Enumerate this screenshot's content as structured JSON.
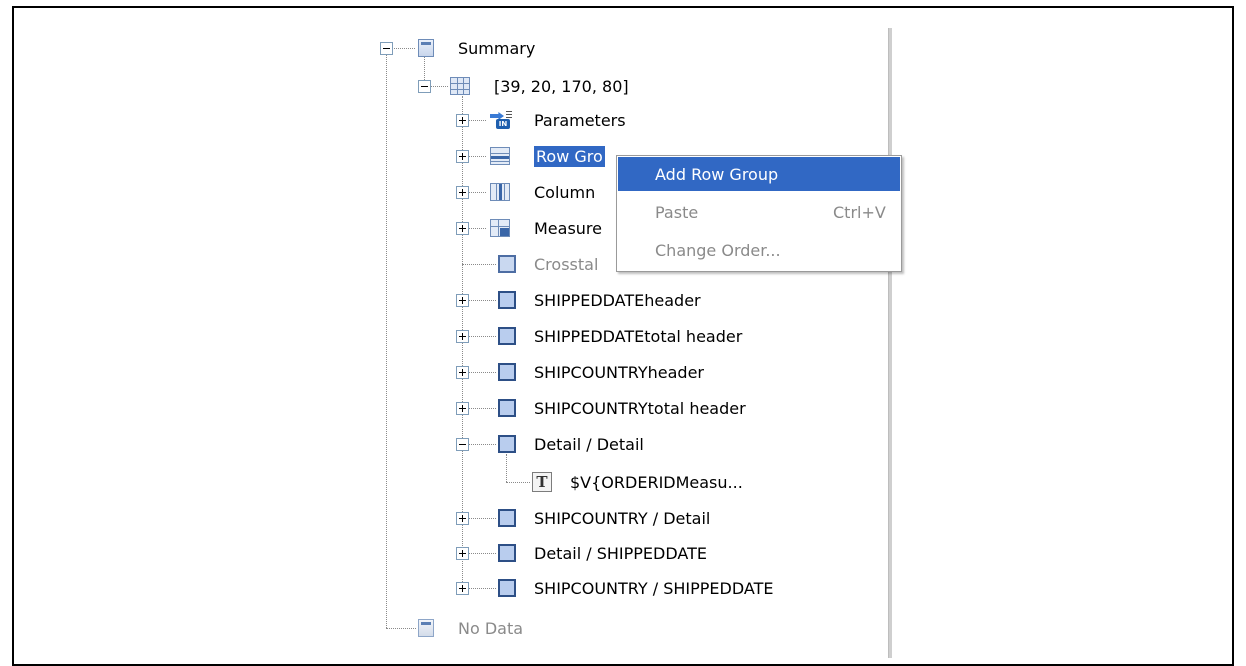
{
  "tree": {
    "items": [
      {
        "id": "summary",
        "label": "Summary",
        "icon": "band-icon",
        "expander": "minus",
        "enabled": true
      },
      {
        "id": "crosstab",
        "label": "[39, 20, 170, 80]",
        "icon": "crosstab-icon",
        "expander": "minus",
        "enabled": true
      },
      {
        "id": "parameters",
        "label": "Parameters",
        "icon": "parameters-icon",
        "expander": "plus",
        "enabled": true
      },
      {
        "id": "row-groups",
        "label": "Row Groups",
        "icon": "row-group-icon",
        "expander": "plus",
        "selected": true,
        "enabled": true
      },
      {
        "id": "column-groups",
        "label": "Column Groups",
        "icon": "column-group-icon",
        "expander": "plus",
        "enabled": true
      },
      {
        "id": "measures",
        "label": "Measures",
        "icon": "measure-icon",
        "expander": "plus",
        "enabled": true
      },
      {
        "id": "crosstab-header",
        "label": "Crosstab header",
        "icon": "cell-icon",
        "expander": "none",
        "enabled": false
      },
      {
        "id": "shippeddate-header",
        "label": "SHIPPEDDATEheader",
        "icon": "cell-icon",
        "expander": "plus",
        "enabled": true
      },
      {
        "id": "shippeddate-total-header",
        "label": "SHIPPEDDATEtotal header",
        "icon": "cell-icon",
        "expander": "plus",
        "enabled": true
      },
      {
        "id": "shipcountry-header",
        "label": "SHIPCOUNTRYheader",
        "icon": "cell-icon",
        "expander": "plus",
        "enabled": true
      },
      {
        "id": "shipcountry-total-header",
        "label": "SHIPCOUNTRYtotal header",
        "icon": "cell-icon",
        "expander": "plus",
        "enabled": true
      },
      {
        "id": "detail-detail",
        "label": "Detail / Detail",
        "icon": "cell-icon",
        "expander": "minus",
        "enabled": true
      },
      {
        "id": "orderid-measure",
        "label": "$V{ORDERIDMeasu...",
        "icon": "text-field-icon",
        "expander": "none",
        "enabled": true
      },
      {
        "id": "shipcountry-detail",
        "label": "SHIPCOUNTRY / Detail",
        "icon": "cell-icon",
        "expander": "plus",
        "enabled": true
      },
      {
        "id": "detail-shippeddate",
        "label": "Detail / SHIPPEDDATE",
        "icon": "cell-icon",
        "expander": "plus",
        "enabled": true
      },
      {
        "id": "shipcountry-shippeddate",
        "label": "SHIPCOUNTRY / SHIPPEDDATE",
        "icon": "cell-icon",
        "expander": "plus",
        "enabled": true
      },
      {
        "id": "no-data",
        "label": "No Data",
        "icon": "band-icon",
        "expander": "none",
        "enabled": false
      }
    ],
    "visible_labels": {
      "row_groups": "Row Gro",
      "column_groups": "Column",
      "measures": "Measure",
      "crosstab_header": "Crosstal"
    },
    "text_field_glyph": "T"
  },
  "context_menu": {
    "items": [
      {
        "label": "Add Row Group",
        "shortcut": "",
        "enabled": true,
        "highlighted": true
      },
      {
        "label": "Paste",
        "shortcut": "Ctrl+V",
        "enabled": false,
        "highlighted": false
      },
      {
        "label": "Change Order...",
        "shortcut": "",
        "enabled": false,
        "highlighted": false
      }
    ]
  },
  "colors": {
    "selection": "#3168c4",
    "disabled_text": "#8a8a8a",
    "cell_icon_border": "#2d4f86",
    "cell_icon_fill": "#b9cdee"
  }
}
